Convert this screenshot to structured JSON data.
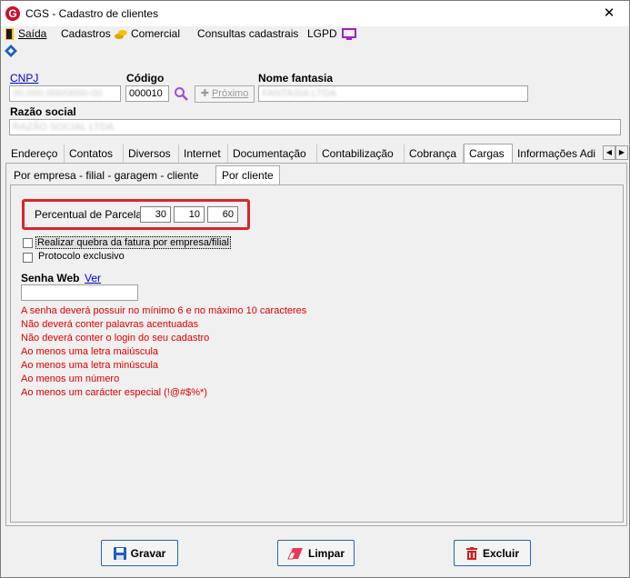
{
  "window": {
    "title": "CGS - Cadastro de clientes",
    "logo_letter": "G"
  },
  "menu": {
    "saida": "Saída",
    "cadastros": "Cadastros",
    "comercial": "Comercial",
    "consultas": "Consultas cadastrais",
    "lgpd": "LGPD"
  },
  "form": {
    "cnpj_label": "CNPJ",
    "cnpj_value": "00.000.000/0000-00",
    "codigo_label": "Código",
    "codigo_value": "000010",
    "proximo_label": "Próximo",
    "nome_fantasia_label": "Nome fantasia",
    "nome_fantasia_value": "FANTASIA LTDA",
    "razao_social_label": "Razão social",
    "razao_social_value": "RAZÃO SOCIAL LTDA"
  },
  "tabs": [
    "Endereço",
    "Contatos",
    "Diversos",
    "Internet",
    "Documentação",
    "Contabilização",
    "Cobrança",
    "Cargas",
    "Informações Adi"
  ],
  "subtabs": [
    "Por empresa - filial - garagem - cliente",
    "Por cliente"
  ],
  "cargas": {
    "percentual_label": "Percentual de Parcelas",
    "parcelas": [
      "30",
      "10",
      "60"
    ],
    "quebra_label": "Realizar quebra da fatura por empresa/filial",
    "protocolo_label": "Protocolo exclusivo",
    "senha_label": "Senha Web",
    "ver_label": "Ver",
    "rules": [
      "A senha deverá possuir no mínimo 6 e no máximo 10 caracteres",
      "Não deverá conter palavras acentuadas",
      "Não deverá conter o login do seu cadastro",
      "Ao menos uma letra maiúscula",
      "Ao menos uma letra minúscula",
      "Ao menos um número",
      "Ao menos um carácter especial (!@#$%*)"
    ]
  },
  "buttons": {
    "gravar": "Gravar",
    "limpar": "Limpar",
    "excluir": "Excluir"
  },
  "colors": {
    "accent_red": "#d9262b",
    "rule_text": "#e00000",
    "button_border": "#2a64b3"
  }
}
